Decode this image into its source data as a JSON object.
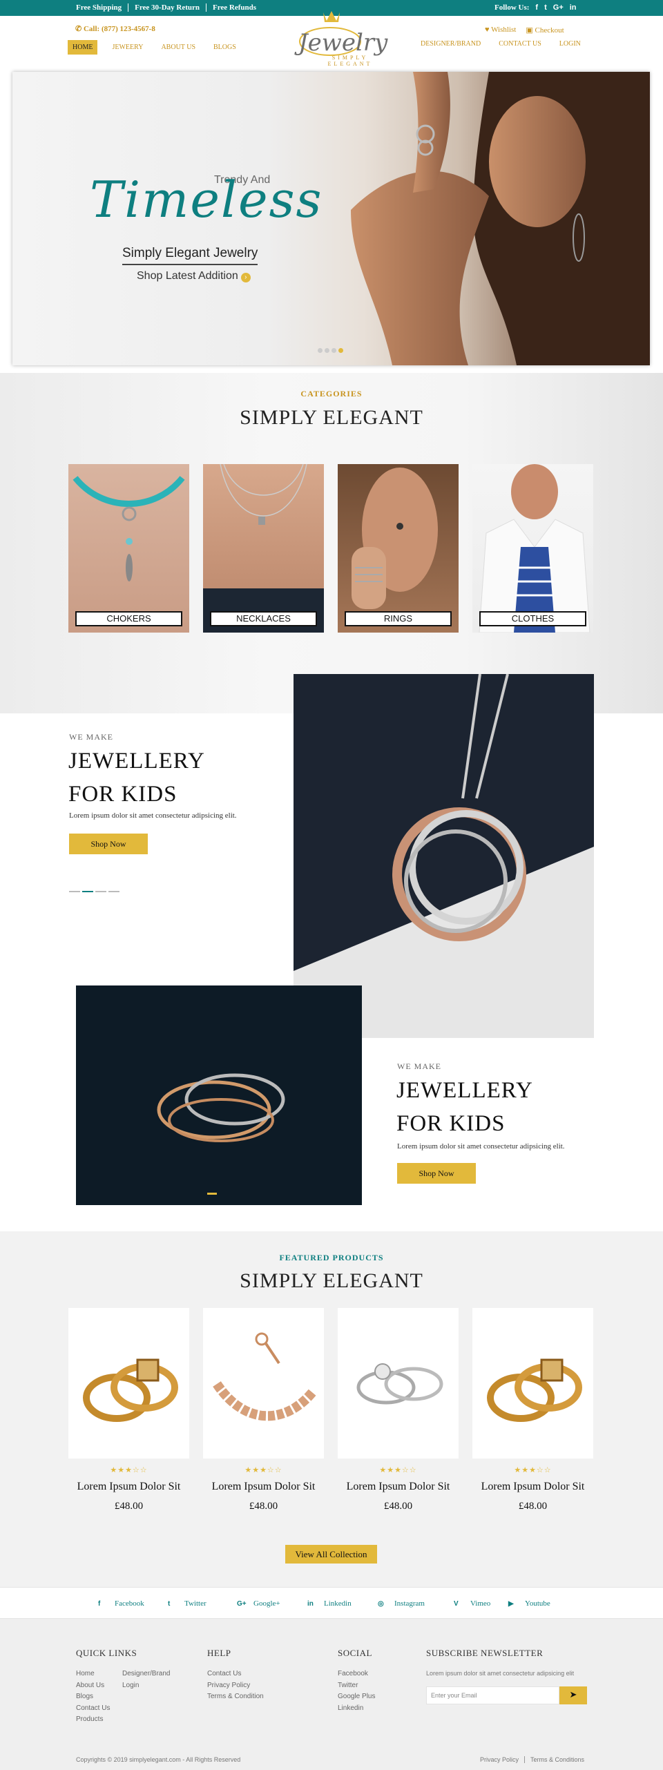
{
  "topbar": {
    "notices": [
      "Free Shipping",
      "Free 30-Day Return",
      "Free Refunds"
    ],
    "follow_label": "Follow Us:",
    "follow_icons": [
      "f",
      "t",
      "G+",
      "in"
    ]
  },
  "header": {
    "call": "Call: (877) 123-4567-8",
    "wishlist": "Wishlist",
    "checkout": "Checkout",
    "logo": {
      "script": "Jewelry",
      "sub": "SIMPLY ELEGANT"
    },
    "nav_left": [
      "HOME",
      "JEWEERY",
      "ABOUT US",
      "BLOGS"
    ],
    "nav_right": [
      "DESIGNER/BRAND",
      "CONTACT US",
      "LOGIN"
    ]
  },
  "hero": {
    "trendy": "Trendy And",
    "timeless": "Timeless",
    "tagline": "Simply Elegant Jewelry",
    "cta": "Shop Latest Addition",
    "slides": 4,
    "active_slide": 4
  },
  "categories": {
    "eyebrow": "CATEGORIES",
    "title": "SIMPLY ELEGANT",
    "items": [
      "CHOKERS",
      "NECKLACES",
      "RINGS",
      "CLOTHES"
    ]
  },
  "promo1": {
    "eyebrow": "WE MAKE",
    "title_line1": "JEWELLERY",
    "title_line2": "FOR KIDS",
    "body": "Lorem ipsum dolor sit amet consectetur adipsicing elit.",
    "button": "Shop Now"
  },
  "promo2": {
    "eyebrow": "WE MAKE",
    "title_line1": "JEWELLERY",
    "title_line2": "FOR KIDS",
    "body": "Lorem ipsum dolor sit amet consectetur adipsicing elit.",
    "button": "Shop Now"
  },
  "featured": {
    "eyebrow": "FEATURED PRODUCTS",
    "title": "SIMPLY ELEGANT",
    "products": [
      {
        "name": "Lorem Ipsum Dolor Sit",
        "price": "£48.00",
        "rating": 3
      },
      {
        "name": "Lorem Ipsum Dolor Sit",
        "price": "£48.00",
        "rating": 3
      },
      {
        "name": "Lorem Ipsum Dolor Sit",
        "price": "£48.00",
        "rating": 3
      },
      {
        "name": "Lorem Ipsum Dolor Sit",
        "price": "£48.00",
        "rating": 3
      }
    ],
    "view_all": "View All Collection"
  },
  "social_bar": [
    {
      "icon": "f",
      "label": "Facebook"
    },
    {
      "icon": "t",
      "label": "Twitter"
    },
    {
      "icon": "G+",
      "label": "Google+"
    },
    {
      "icon": "in",
      "label": "Linkedin"
    },
    {
      "icon": "◎",
      "label": "Instagram"
    },
    {
      "icon": "V",
      "label": "Vimeo"
    },
    {
      "icon": "▶",
      "label": "Youtube"
    }
  ],
  "footer": {
    "quick_links": {
      "title": "QUICK LINKS",
      "col1": [
        "Home",
        "About Us",
        "Blogs",
        "Contact Us",
        "Products"
      ],
      "col2": [
        "Designer/Brand",
        "Login"
      ]
    },
    "help": {
      "title": "HELP",
      "links": [
        "Contact Us",
        "Privacy Policy",
        "Terms & Condition"
      ]
    },
    "social": {
      "title": "SOCIAL",
      "links": [
        "Facebook",
        "Twitter",
        "Google Plus",
        "Linkedin"
      ]
    },
    "newsletter": {
      "title": "SUBSCRIBE NEWSLETTER",
      "text": "Lorem ipsum dolor sit amet consectetur adipsicing elit",
      "placeholder": "Enter your Email"
    },
    "copyright": "Copyrights © 2019 simplyelegant.com - All Rights Reserved",
    "legal": [
      "Privacy Policy",
      "Terms & Conditions"
    ]
  },
  "colors": {
    "teal": "#0e7f80",
    "gold": "#e2b93b",
    "gold_text": "#c8941f"
  }
}
